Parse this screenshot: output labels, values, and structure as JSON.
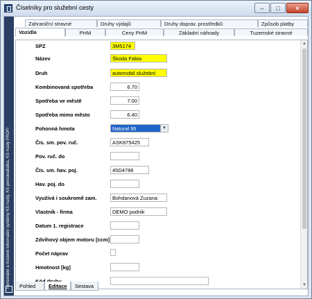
{
  "window": {
    "title": "Číselníky pro služební cesty",
    "minimize": "–",
    "maximize": "□",
    "close": "×"
  },
  "sidebar": {
    "text": "Personální a mzdové informační systémy KS mzdy, KS personalistika, KS mzdy PROFI"
  },
  "tabs_row1": [
    "Zahraniční stravné",
    "Druhy výdajů",
    "Druhy doprav. prostředků",
    "Způsob platby"
  ],
  "tabs_row2": [
    "Vozidla",
    "PHM",
    "Ceny PHM",
    "Základní náhrady",
    "Tuzemské stravné"
  ],
  "fields": [
    {
      "label": "SPZ",
      "value": "3M5174"
    },
    {
      "label": "Název",
      "value": "Škoda Fabia"
    },
    {
      "label": "Druh",
      "value": "automobil služební"
    },
    {
      "label": "Kombinovaná spotřeba",
      "value": "6.70"
    },
    {
      "label": "Spotřeba ve městě",
      "value": "7.00"
    },
    {
      "label": "Spotřeba mimo město",
      "value": "6.40"
    },
    {
      "label": "Pohonná hmota",
      "value": "Natural 95"
    },
    {
      "label": "Čís. sm. pov. ruč.",
      "value": "ASK875425"
    },
    {
      "label": "Pov. ruč. do",
      "value": ""
    },
    {
      "label": "Čís. sm. hav. poj.",
      "value": "45D4788"
    },
    {
      "label": "Hav. poj. do",
      "value": ""
    },
    {
      "label": "Využívá i soukromě zam.",
      "value": "Bohdanová Zuzana"
    },
    {
      "label": "Vlastník - firma",
      "value": "DEMO podnik"
    },
    {
      "label": "Datum 1. registrace",
      "value": ""
    },
    {
      "label": "Zdvihový objem motoru [ccm]",
      "value": ""
    },
    {
      "label": "Počet náprav",
      "value": ""
    },
    {
      "label": "Hmotnost [kg]",
      "value": ""
    },
    {
      "label": "Kód druhu",
      "value": ""
    }
  ],
  "bottom_tabs": [
    "Pohled",
    "Editace",
    "Sestava"
  ]
}
